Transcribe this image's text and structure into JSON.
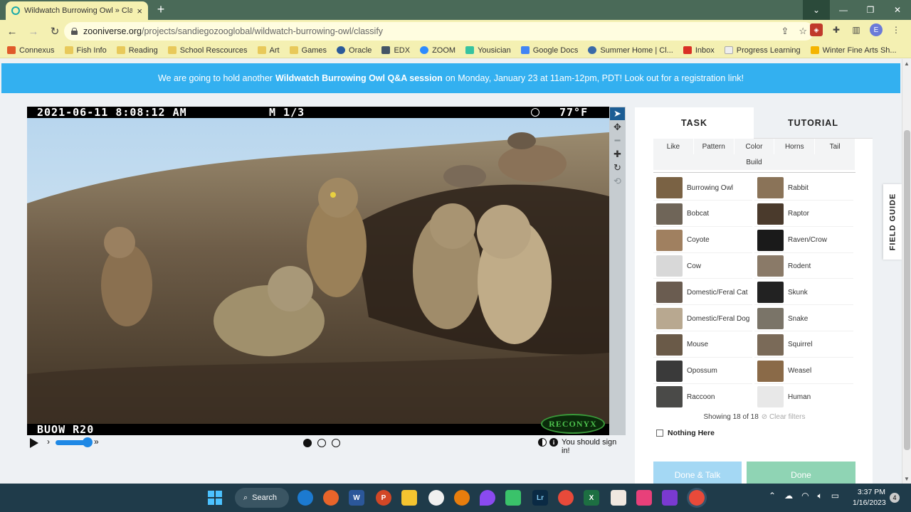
{
  "browser": {
    "tab_title": "Wildwatch Burrowing Owl » Clas",
    "tab_close": "×",
    "new_tab": "+",
    "url_host": "zooniverse.org",
    "url_path": "/projects/sandiegozooglobal/wildwatch-burrowing-owl/classify",
    "profile_initial": "E"
  },
  "bookmarks": [
    "Connexus",
    "Fish Info",
    "Reading",
    "School Rescources",
    "Art",
    "Games",
    "Oracle",
    "EDX",
    "ZOOM",
    "Yousician",
    "Google Docs",
    "Summer Home | Cl...",
    "Inbox",
    "Progress Learning",
    "Winter Fine Arts Sh..."
  ],
  "banner": {
    "prefix": "We are going to hold another",
    "bold": "Wildwatch Burrowing Owl Q&A session",
    "suffix": "on Monday, January 23 at 11am-12pm, PDT! Look out for a registration link!"
  },
  "camera": {
    "date": "2021-06-11 8:08:12 AM",
    "mode": "M 1/3",
    "temp": "77°F",
    "id": "BUOW R20",
    "brand": "RECONYX"
  },
  "controls": {
    "speed_level": 0.9,
    "frames": 3,
    "current_frame": 1,
    "signin_text": "You should sign in!"
  },
  "panel": {
    "tab_task": "TASK",
    "tab_tutorial": "TUTORIAL",
    "filters_row1": [
      "Like",
      "Pattern",
      "Color",
      "Horns",
      "Tail"
    ],
    "filters_row2": [
      "Build"
    ],
    "choices": [
      {
        "label": "Burrowing Owl",
        "color": "#7a6244"
      },
      {
        "label": "Rabbit",
        "color": "#8a7358"
      },
      {
        "label": "Bobcat",
        "color": "#6f6558"
      },
      {
        "label": "Raptor",
        "color": "#4a3a2c"
      },
      {
        "label": "Coyote",
        "color": "#a08060"
      },
      {
        "label": "Raven/Crow",
        "color": "#1a1a1a"
      },
      {
        "label": "Cow",
        "color": "#d8d8d8"
      },
      {
        "label": "Rodent",
        "color": "#8a7a68"
      },
      {
        "label": "Domestic/Feral Cat",
        "color": "#6a5c50"
      },
      {
        "label": "Skunk",
        "color": "#222222"
      },
      {
        "label": "Domestic/Feral Dog",
        "color": "#b8a890"
      },
      {
        "label": "Snake",
        "color": "#7a7468"
      },
      {
        "label": "Mouse",
        "color": "#6a5a48"
      },
      {
        "label": "Squirrel",
        "color": "#7a6a58"
      },
      {
        "label": "Opossum",
        "color": "#3a3a3a"
      },
      {
        "label": "Weasel",
        "color": "#8a6a48"
      },
      {
        "label": "Raccoon",
        "color": "#4a4a48"
      },
      {
        "label": "Human",
        "color": "#e8e8e8"
      }
    ],
    "showing": "Showing 18 of 18",
    "clear_filters": "Clear filters",
    "nothing_here": "Nothing Here",
    "done_talk": "Done & Talk",
    "done": "Done",
    "field_guide": "FIELD GUIDE"
  },
  "taskbar": {
    "search": "Search",
    "time": "3:37 PM",
    "date": "1/16/2023",
    "notifications": "4"
  }
}
